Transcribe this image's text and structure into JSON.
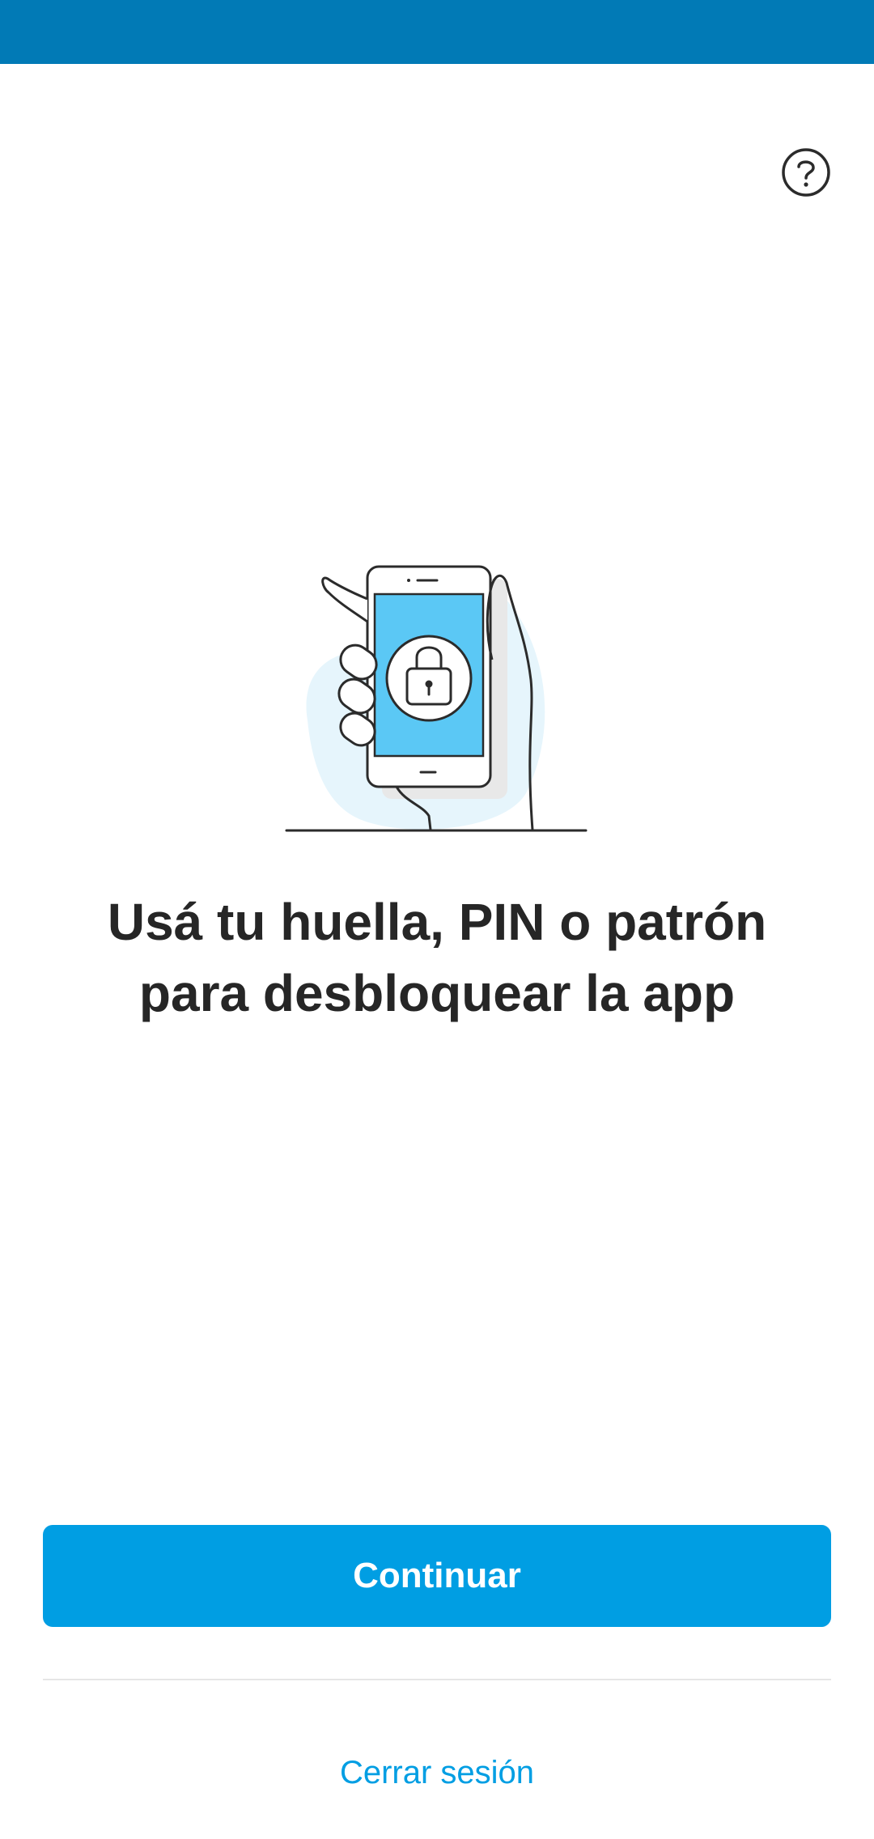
{
  "colors": {
    "status_bar": "#017ab6",
    "primary": "#009ee3",
    "text": "#262626",
    "illustration_screen": "#5bc8f5",
    "illustration_blob": "#e6f5fc"
  },
  "help": {
    "icon": "question-circle-icon"
  },
  "illustration": {
    "icon": "hand-phone-lock-illustration"
  },
  "headline": {
    "line1": "Usá tu huella, PIN o patrón",
    "line2": "para desbloquear la app"
  },
  "actions": {
    "continue_label": "Continuar",
    "logout_label": "Cerrar sesión"
  }
}
